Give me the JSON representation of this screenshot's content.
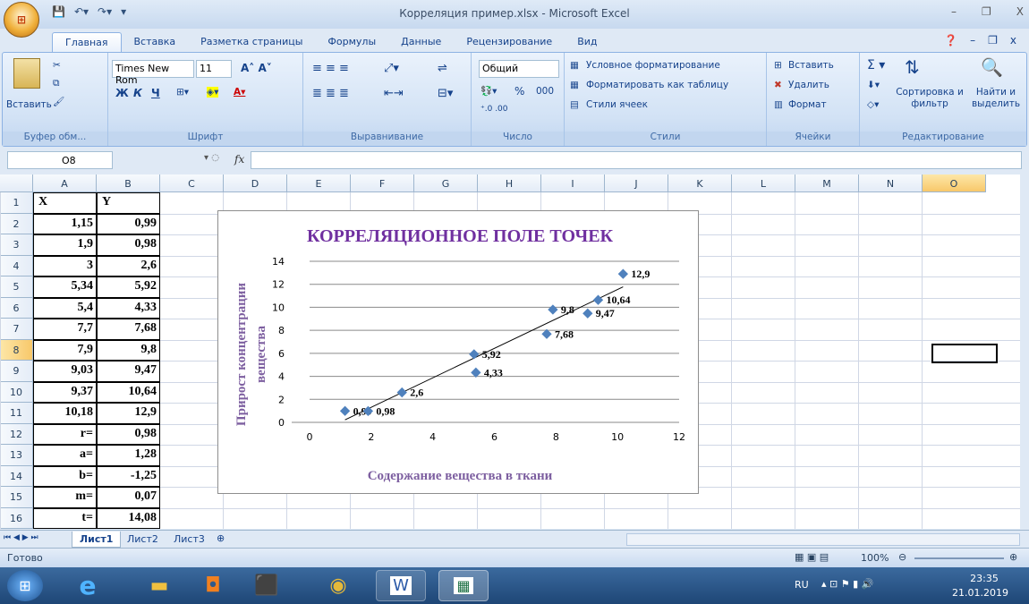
{
  "window": {
    "title": "Корреляция пример.xlsx - Microsoft Excel"
  },
  "tabs": [
    "Главная",
    "Вставка",
    "Разметка страницы",
    "Формулы",
    "Данные",
    "Рецензирование",
    "Вид"
  ],
  "ribbon": {
    "clipboard": {
      "paste": "Вставить",
      "label": "Буфер обм..."
    },
    "font": {
      "name": "Times New Rom",
      "size": "11",
      "bold": "Ж",
      "italic": "К",
      "underline": "Ч",
      "label": "Шрифт"
    },
    "alignment": {
      "label": "Выравнивание"
    },
    "number": {
      "format": "Общий",
      "percent": "%",
      "thousands": "000",
      "label": "Число"
    },
    "styles": {
      "conditional": "Условное форматирование",
      "as_table": "Форматировать как таблицу",
      "cell_styles": "Стили ячеек",
      "label": "Стили"
    },
    "cells": {
      "insert": "Вставить",
      "delete": "Удалить",
      "format": "Формат",
      "label": "Ячейки"
    },
    "editing": {
      "sort": "Сортировка и фильтр",
      "find": "Найти и выделить",
      "label": "Редактирование"
    }
  },
  "formula_bar": {
    "name_box": "O8",
    "fx": "fx",
    "value": ""
  },
  "columns": [
    "A",
    "B",
    "C",
    "D",
    "E",
    "F",
    "G",
    "H",
    "I",
    "J",
    "K",
    "L",
    "M",
    "N",
    "O"
  ],
  "rows": [
    "1",
    "2",
    "3",
    "4",
    "5",
    "6",
    "7",
    "8",
    "9",
    "10",
    "11",
    "12",
    "13",
    "14",
    "15",
    "16"
  ],
  "cells": {
    "header": {
      "x": "X",
      "y": "Y"
    },
    "data": [
      [
        "1,15",
        "0,99"
      ],
      [
        "1,9",
        "0,98"
      ],
      [
        "3",
        "2,6"
      ],
      [
        "5,34",
        "5,92"
      ],
      [
        "5,4",
        "4,33"
      ],
      [
        "7,7",
        "7,68"
      ],
      [
        "7,9",
        "9,8"
      ],
      [
        "9,03",
        "9,47"
      ],
      [
        "9,37",
        "10,64"
      ],
      [
        "10,18",
        "12,9"
      ]
    ],
    "stats": [
      [
        "r=",
        "0,98"
      ],
      [
        "a=",
        "1,28"
      ],
      [
        "b=",
        "-1,25"
      ],
      [
        "m=",
        "0,07"
      ],
      [
        "t=",
        "14,08"
      ]
    ]
  },
  "chart_data": {
    "type": "scatter",
    "title": "КОРРЕЛЯЦИОННОЕ ПОЛЕ ТОЧЕК",
    "xlabel": "Содержание вещества в ткани",
    "ylabel_line1": "Прирост концентрации",
    "ylabel_line2": "вещества",
    "xlim": [
      0,
      12
    ],
    "ylim": [
      0,
      14
    ],
    "xticks": [
      "0",
      "2",
      "4",
      "6",
      "8",
      "10",
      "12"
    ],
    "yticks": [
      "0",
      "2",
      "4",
      "6",
      "8",
      "10",
      "12",
      "14"
    ],
    "x": [
      1.15,
      1.9,
      3,
      5.34,
      5.4,
      7.7,
      7.9,
      9.03,
      9.37,
      10.18
    ],
    "y": [
      0.99,
      0.98,
      2.6,
      5.92,
      4.33,
      7.68,
      9.8,
      9.47,
      10.64,
      12.9
    ],
    "labels": [
      "0,99",
      "0,98",
      "2,6",
      "5,92",
      "4,33",
      "7,68",
      "9,8",
      "9,47",
      "10,64",
      "12,9"
    ],
    "trendline": {
      "slope": 1.28,
      "intercept": -1.25,
      "x_from": 1.15,
      "x_to": 10.18
    },
    "grid": true,
    "marker_color": "#4f81bd"
  },
  "sheets": [
    "Лист1",
    "Лист2",
    "Лист3"
  ],
  "status": {
    "ready": "Готово",
    "zoom": "100%"
  },
  "taskbar": {
    "lang": "RU",
    "time": "23:35",
    "date": "21.01.2019"
  }
}
